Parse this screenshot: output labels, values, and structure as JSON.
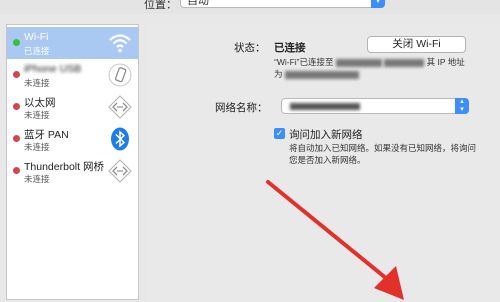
{
  "location": {
    "label": "位置：",
    "value": "自动"
  },
  "sidebar": {
    "items": [
      {
        "name": "Wi-Fi",
        "status": "已连接",
        "dot_color": "#3bbf3b",
        "icon": "wifi-icon",
        "selected": true
      },
      {
        "name": "iPhone USB",
        "status": "未连接",
        "dot_color": "#d9434b",
        "icon": "phone-icon",
        "selected": false
      },
      {
        "name": "以太网",
        "status": "未连接",
        "dot_color": "#d9434b",
        "icon": "ethernet-icon",
        "selected": false
      },
      {
        "name": "蓝牙 PAN",
        "status": "未连接",
        "dot_color": "#d9434b",
        "icon": "bluetooth-icon",
        "selected": false
      },
      {
        "name": "Thunderbolt 网桥",
        "status": "未连接",
        "dot_color": "#d9434b",
        "icon": "thunderbolt-bridge-icon",
        "selected": false
      }
    ]
  },
  "main": {
    "status_label": "状态：",
    "status_value": "已连接",
    "turn_off_button": "关闭 Wi-Fi",
    "status_desc_line1_prefix": "“Wi-Fi”已连接至",
    "status_desc_line1_suffix": "其 IP 地址",
    "status_desc_line2_prefix": "为",
    "network_name_label": "网络名称：",
    "ask_join_label": "询问加入新网络",
    "ask_join_checked": true,
    "ask_join_desc_line1": "将自动加入已知网络。如果没有已知网络，将询问",
    "ask_join_desc_line2": "您是否加入新网络。"
  },
  "colors": {
    "accent": "#3d8ff7",
    "annotation_arrow": "#e2312b",
    "selected_row": "#a9c9f2"
  }
}
